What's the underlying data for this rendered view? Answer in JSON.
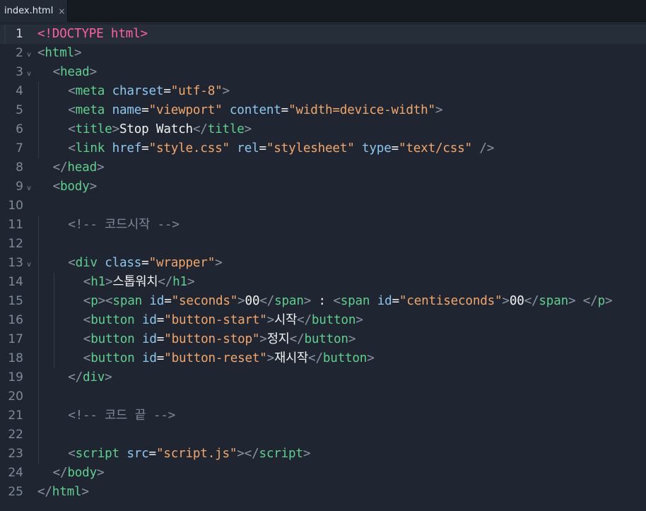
{
  "tab": {
    "filename": "index.html",
    "close_glyph": "×"
  },
  "lines": [
    {
      "num": "1",
      "fold": false,
      "active": true,
      "indent": 0,
      "tokens": [
        [
          "d",
          "<!DOCTYPE html>"
        ]
      ]
    },
    {
      "num": "2",
      "fold": true,
      "indent": 0,
      "tokens": [
        [
          "b",
          "<"
        ],
        [
          "t",
          "html"
        ],
        [
          "b",
          ">"
        ]
      ]
    },
    {
      "num": "3",
      "fold": true,
      "indent": 1,
      "tokens": [
        [
          "b",
          "<"
        ],
        [
          "t",
          "head"
        ],
        [
          "b",
          ">"
        ]
      ]
    },
    {
      "num": "4",
      "fold": false,
      "indent": 2,
      "tokens": [
        [
          "b",
          "<"
        ],
        [
          "t",
          "meta"
        ],
        [
          "x",
          " "
        ],
        [
          "a",
          "charset"
        ],
        [
          "x",
          "="
        ],
        [
          "s",
          "\"utf-8\""
        ],
        [
          "b",
          ">"
        ]
      ]
    },
    {
      "num": "5",
      "fold": false,
      "indent": 2,
      "tokens": [
        [
          "b",
          "<"
        ],
        [
          "t",
          "meta"
        ],
        [
          "x",
          " "
        ],
        [
          "a",
          "name"
        ],
        [
          "x",
          "="
        ],
        [
          "s",
          "\"viewport\""
        ],
        [
          "x",
          " "
        ],
        [
          "a",
          "content"
        ],
        [
          "x",
          "="
        ],
        [
          "s",
          "\"width=device-width\""
        ],
        [
          "b",
          ">"
        ]
      ]
    },
    {
      "num": "6",
      "fold": false,
      "indent": 2,
      "tokens": [
        [
          "b",
          "<"
        ],
        [
          "t",
          "title"
        ],
        [
          "b",
          ">"
        ],
        [
          "x",
          "Stop Watch"
        ],
        [
          "b",
          "</"
        ],
        [
          "t",
          "title"
        ],
        [
          "b",
          ">"
        ]
      ]
    },
    {
      "num": "7",
      "fold": false,
      "indent": 2,
      "tokens": [
        [
          "b",
          "<"
        ],
        [
          "t",
          "link"
        ],
        [
          "x",
          " "
        ],
        [
          "a",
          "href"
        ],
        [
          "x",
          "="
        ],
        [
          "s",
          "\"style.css\""
        ],
        [
          "x",
          " "
        ],
        [
          "a",
          "rel"
        ],
        [
          "x",
          "="
        ],
        [
          "s",
          "\"stylesheet\""
        ],
        [
          "x",
          " "
        ],
        [
          "a",
          "type"
        ],
        [
          "x",
          "="
        ],
        [
          "s",
          "\"text/css\""
        ],
        [
          "x",
          " "
        ],
        [
          "b",
          "/>"
        ]
      ]
    },
    {
      "num": "8",
      "fold": false,
      "indent": 1,
      "tokens": [
        [
          "b",
          "</"
        ],
        [
          "t",
          "head"
        ],
        [
          "b",
          ">"
        ]
      ]
    },
    {
      "num": "9",
      "fold": true,
      "indent": 1,
      "tokens": [
        [
          "b",
          "<"
        ],
        [
          "t",
          "body"
        ],
        [
          "b",
          ">"
        ]
      ]
    },
    {
      "num": "10",
      "fold": false,
      "indent": 0,
      "tokens": []
    },
    {
      "num": "11",
      "fold": false,
      "indent": 2,
      "tokens": [
        [
          "c",
          "<!-- 코드시작 -->"
        ]
      ]
    },
    {
      "num": "12",
      "fold": false,
      "indent": 0,
      "tokens": []
    },
    {
      "num": "13",
      "fold": true,
      "indent": 2,
      "tokens": [
        [
          "b",
          "<"
        ],
        [
          "t",
          "div"
        ],
        [
          "x",
          " "
        ],
        [
          "a",
          "class"
        ],
        [
          "x",
          "="
        ],
        [
          "s",
          "\"wrapper\""
        ],
        [
          "b",
          ">"
        ]
      ]
    },
    {
      "num": "14",
      "fold": false,
      "indent": 3,
      "tokens": [
        [
          "b",
          "<"
        ],
        [
          "t",
          "h1"
        ],
        [
          "b",
          ">"
        ],
        [
          "x",
          "스톱워치"
        ],
        [
          "b",
          "</"
        ],
        [
          "t",
          "h1"
        ],
        [
          "b",
          ">"
        ]
      ]
    },
    {
      "num": "15",
      "fold": false,
      "indent": 3,
      "tokens": [
        [
          "b",
          "<"
        ],
        [
          "t",
          "p"
        ],
        [
          "b",
          ">"
        ],
        [
          "b",
          "<"
        ],
        [
          "t",
          "span"
        ],
        [
          "x",
          " "
        ],
        [
          "a",
          "id"
        ],
        [
          "x",
          "="
        ],
        [
          "s",
          "\"seconds\""
        ],
        [
          "b",
          ">"
        ],
        [
          "x",
          "00"
        ],
        [
          "b",
          "</"
        ],
        [
          "t",
          "span"
        ],
        [
          "b",
          ">"
        ],
        [
          "x",
          " : "
        ],
        [
          "b",
          "<"
        ],
        [
          "t",
          "span"
        ],
        [
          "x",
          " "
        ],
        [
          "a",
          "id"
        ],
        [
          "x",
          "="
        ],
        [
          "s",
          "\"centiseconds\""
        ],
        [
          "b",
          ">"
        ],
        [
          "x",
          "00"
        ],
        [
          "b",
          "</"
        ],
        [
          "t",
          "span"
        ],
        [
          "b",
          ">"
        ],
        [
          "x",
          " "
        ],
        [
          "b",
          "</"
        ],
        [
          "t",
          "p"
        ],
        [
          "b",
          ">"
        ]
      ]
    },
    {
      "num": "16",
      "fold": false,
      "indent": 3,
      "tokens": [
        [
          "b",
          "<"
        ],
        [
          "t",
          "button"
        ],
        [
          "x",
          " "
        ],
        [
          "a",
          "id"
        ],
        [
          "x",
          "="
        ],
        [
          "s",
          "\"button-start\""
        ],
        [
          "b",
          ">"
        ],
        [
          "x",
          "시작"
        ],
        [
          "b",
          "</"
        ],
        [
          "t",
          "button"
        ],
        [
          "b",
          ">"
        ]
      ]
    },
    {
      "num": "17",
      "fold": false,
      "indent": 3,
      "tokens": [
        [
          "b",
          "<"
        ],
        [
          "t",
          "button"
        ],
        [
          "x",
          " "
        ],
        [
          "a",
          "id"
        ],
        [
          "x",
          "="
        ],
        [
          "s",
          "\"button-stop\""
        ],
        [
          "b",
          ">"
        ],
        [
          "x",
          "정지"
        ],
        [
          "b",
          "</"
        ],
        [
          "t",
          "button"
        ],
        [
          "b",
          ">"
        ]
      ]
    },
    {
      "num": "18",
      "fold": false,
      "indent": 3,
      "tokens": [
        [
          "b",
          "<"
        ],
        [
          "t",
          "button"
        ],
        [
          "x",
          " "
        ],
        [
          "a",
          "id"
        ],
        [
          "x",
          "="
        ],
        [
          "s",
          "\"button-reset\""
        ],
        [
          "b",
          ">"
        ],
        [
          "x",
          "재시작"
        ],
        [
          "b",
          "</"
        ],
        [
          "t",
          "button"
        ],
        [
          "b",
          ">"
        ]
      ]
    },
    {
      "num": "19",
      "fold": false,
      "indent": 2,
      "tokens": [
        [
          "b",
          "</"
        ],
        [
          "t",
          "div"
        ],
        [
          "b",
          ">"
        ]
      ]
    },
    {
      "num": "20",
      "fold": false,
      "indent": 0,
      "tokens": []
    },
    {
      "num": "21",
      "fold": false,
      "indent": 2,
      "tokens": [
        [
          "c",
          "<!-- 코드 끝 -->"
        ]
      ]
    },
    {
      "num": "22",
      "fold": false,
      "indent": 0,
      "tokens": []
    },
    {
      "num": "23",
      "fold": false,
      "indent": 2,
      "tokens": [
        [
          "b",
          "<"
        ],
        [
          "t",
          "script"
        ],
        [
          "x",
          " "
        ],
        [
          "a",
          "src"
        ],
        [
          "x",
          "="
        ],
        [
          "s",
          "\"script.js\""
        ],
        [
          "b",
          "></"
        ],
        [
          "t",
          "script"
        ],
        [
          "b",
          ">"
        ]
      ]
    },
    {
      "num": "24",
      "fold": false,
      "indent": 1,
      "tokens": [
        [
          "b",
          "</"
        ],
        [
          "t",
          "body"
        ],
        [
          "b",
          ">"
        ]
      ]
    },
    {
      "num": "25",
      "fold": false,
      "indent": 0,
      "tokens": [
        [
          "b",
          "</"
        ],
        [
          "t",
          "html"
        ],
        [
          "b",
          ">"
        ]
      ]
    }
  ],
  "fold_glyph": "v",
  "colors": {
    "background": "#1f2631",
    "tag": "#5fd08b",
    "attribute": "#8cc7f0",
    "string": "#f3a66a",
    "doctype": "#ff5fa3",
    "comment": "#7c8798"
  }
}
